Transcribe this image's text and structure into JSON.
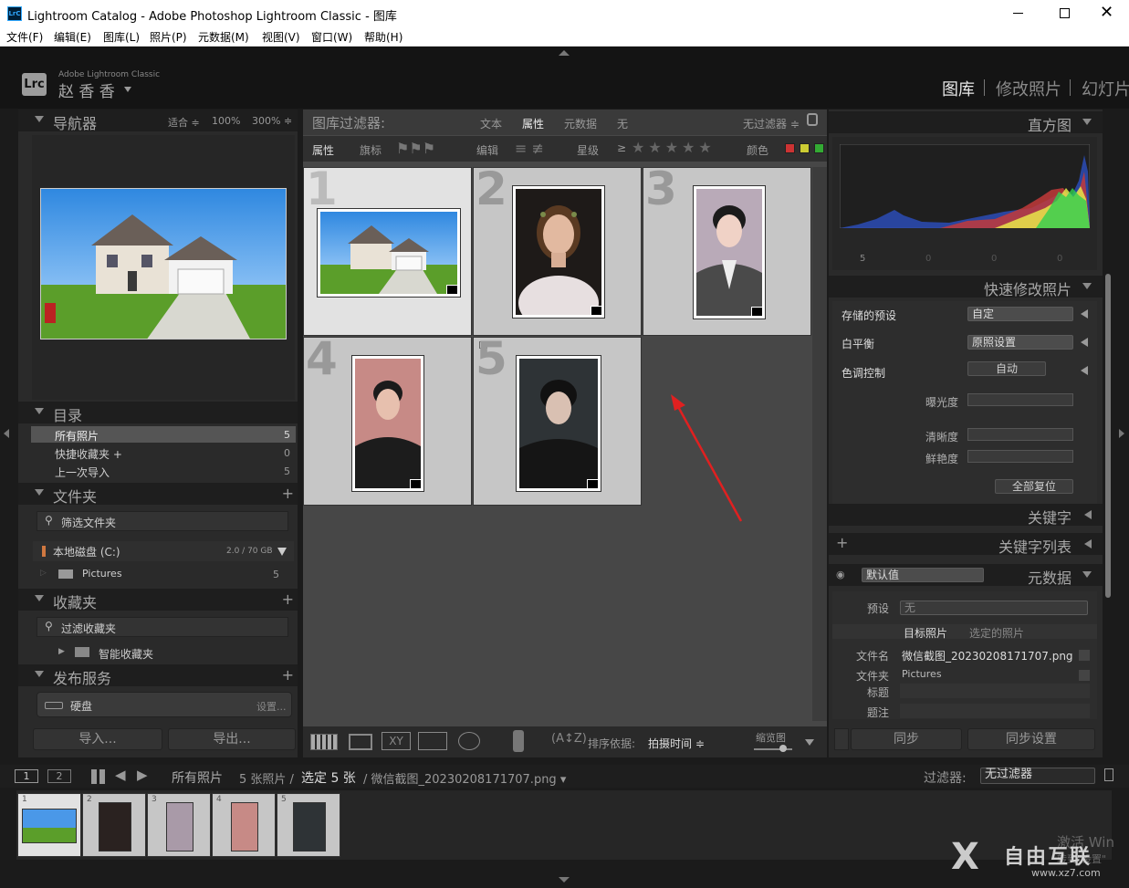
{
  "window": {
    "title": "Lightroom Catalog - Adobe Photoshop Lightroom Classic - 图库",
    "app_icon_text": "LrC"
  },
  "menu": [
    "文件(F)",
    "编辑(E)",
    "图库(L)",
    "照片(P)",
    "元数据(M)",
    "视图(V)",
    "窗口(W)",
    "帮助(H)"
  ],
  "identity": {
    "logo_text": "Lrc",
    "product": "Adobe Lightroom Classic",
    "user": "赵 香 香",
    "modules": [
      "图库",
      "修改照片",
      "幻灯片"
    ]
  },
  "navigator": {
    "title": "导航器",
    "zoom_fit": "适合 ≑",
    "zoom_100": "100%",
    "zoom_300": "300% ≑"
  },
  "catalog": {
    "title": "目录",
    "items": [
      {
        "label": "所有照片",
        "count": "5"
      },
      {
        "label": "快捷收藏夹 +",
        "count": "0"
      },
      {
        "label": "上一次导入",
        "count": "5"
      }
    ]
  },
  "folders": {
    "title": "文件夹",
    "filter_label": "筛选文件夹",
    "volume": "本地磁盘 (C:)",
    "volume_size": "2.0 / 70 GB",
    "folder": "Pictures",
    "folder_count": "5"
  },
  "collections": {
    "title": "收藏夹",
    "filter_label": "过滤收藏夹",
    "smart": "智能收藏夹"
  },
  "publish": {
    "title": "发布服务",
    "disk": "硬盘",
    "setup": "设置..."
  },
  "left_buttons": {
    "import": "导入...",
    "export": "导出..."
  },
  "library_filter": {
    "label": "图库过滤器:",
    "tabs": [
      "文本",
      "属性",
      "元数据",
      "无"
    ],
    "preset": "无过滤器 ≑",
    "attr_label": "属性",
    "flag_label": "旗标",
    "edit_label": "编辑",
    "rating_label": "星级",
    "rating_op": "≥",
    "color_label": "颜色"
  },
  "grid": {
    "cells": [
      {
        "n": "1",
        "name": "house"
      },
      {
        "n": "2",
        "name": "woman"
      },
      {
        "n": "3",
        "name": "man-gray"
      },
      {
        "n": "4",
        "name": "man-pink"
      },
      {
        "n": "5",
        "name": "man-dark"
      }
    ]
  },
  "toolbar": {
    "sort_label": "排序依据:",
    "sort_value": "拍摄时间 ≑",
    "thumb_label": "缩览图"
  },
  "histogram": {
    "title": "直方图",
    "stats": [
      "5",
      "0",
      "0",
      "0"
    ]
  },
  "quick_develop": {
    "title": "快速修改照片",
    "saved_preset_label": "存储的预设",
    "saved_preset_value": "自定",
    "wb_label": "白平衡",
    "wb_value": "原照设置",
    "tone_label": "色调控制",
    "auto": "自动",
    "exposure": "曝光度",
    "clarity": "清晰度",
    "vibrance": "鲜艳度",
    "reset": "全部复位"
  },
  "keywords": {
    "title": "关键字",
    "list_title": "关键字列表"
  },
  "metadata": {
    "title": "元数据",
    "preset_view": "默认值",
    "preset_label": "预设",
    "preset_value": "无",
    "target_tab": "目标照片",
    "selected_tab": "选定的照片",
    "filename_label": "文件名",
    "filename_value": "微信截图_20230208171707.png",
    "folder_label": "文件夹",
    "folder_value": "Pictures",
    "caption_label": "标题",
    "title_label": "题注"
  },
  "right_buttons": {
    "sync": "同步",
    "sync_settings": "同步设置"
  },
  "filmstrip_bar": {
    "screen1": "1",
    "screen2": "2",
    "source": "所有照片",
    "info": "5 张照片 /",
    "selected": "选定 5 张",
    "file": "/ 微信截图_20230208171707.png ▾",
    "filter_label": "过滤器:",
    "filter_value": "无过滤器"
  },
  "filmstrip": {
    "numbers": [
      "1",
      "2",
      "3",
      "4",
      "5"
    ]
  },
  "watermark": {
    "line1": "激活 Win",
    "line2": "转到\"设置\"",
    "brand": "自由互联",
    "url": "www.xz7.com"
  },
  "colors": {
    "bg": "#1b1b1b",
    "panel": "#2a2a2a",
    "grid_bg": "#474747",
    "cell": "#c6c6c6",
    "cell_selected": "#e2e2e2",
    "arrow": "#e02020"
  }
}
